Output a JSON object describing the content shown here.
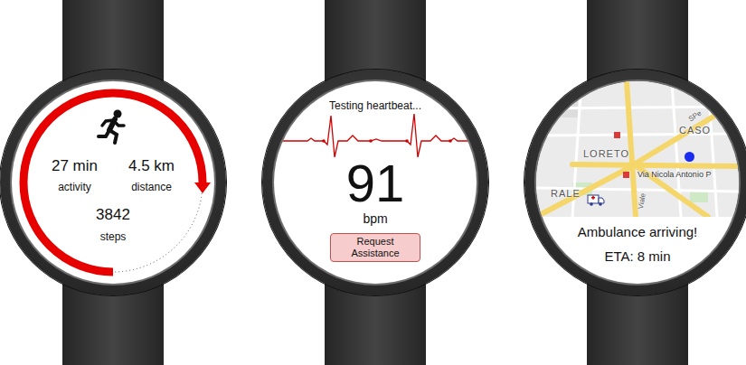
{
  "activity_watch": {
    "ring": {
      "level": 0.75,
      "color": "#e60000"
    },
    "stats": [
      {
        "value": "27 min",
        "label": "activity"
      },
      {
        "value": "4.5 km",
        "label": "distance"
      }
    ],
    "steps": {
      "value": "3842",
      "label": "steps"
    }
  },
  "heart_watch": {
    "status": "Testing heartbeat...",
    "bpm": "91",
    "unit": "bpm",
    "button": "Request Assistance"
  },
  "map_watch": {
    "map_labels": [
      "LORETO",
      "CASO",
      "RALE",
      "Via Nicola Antonio P",
      "Viale",
      "SPe"
    ],
    "message": "Ambulance arriving!",
    "eta": "ETA: 8 min"
  }
}
